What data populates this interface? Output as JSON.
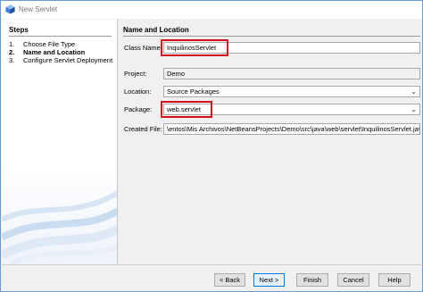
{
  "window": {
    "title": "New Servlet",
    "icon": "netbeans-cube-icon"
  },
  "steps": {
    "heading": "Steps",
    "items": [
      {
        "num": "1.",
        "label": "Choose File Type",
        "active": false
      },
      {
        "num": "2.",
        "label": "Name and Location",
        "active": true
      },
      {
        "num": "3.",
        "label": "Configure Servlet Deployment",
        "active": false
      }
    ]
  },
  "panel": {
    "heading": "Name and Location",
    "class_name": {
      "label": "Class Name:",
      "value": "InquilinosServlet"
    },
    "project": {
      "label": "Project:",
      "value": "Demo"
    },
    "location": {
      "label": "Location:",
      "value": "Source Packages"
    },
    "package": {
      "label": "Package:",
      "value": "web.servlet"
    },
    "created_file": {
      "label": "Created File:",
      "value": "\\entos\\Mis Archivos\\NetBeansProjects\\Demo\\src\\java\\web\\servlet\\InquilinosServlet.java"
    }
  },
  "buttons": {
    "back": "< Back",
    "next": "Next >",
    "finish": "Finish",
    "cancel": "Cancel",
    "help": "Help"
  },
  "colors": {
    "highlight": "#d0101a",
    "accent": "#0078d7"
  }
}
